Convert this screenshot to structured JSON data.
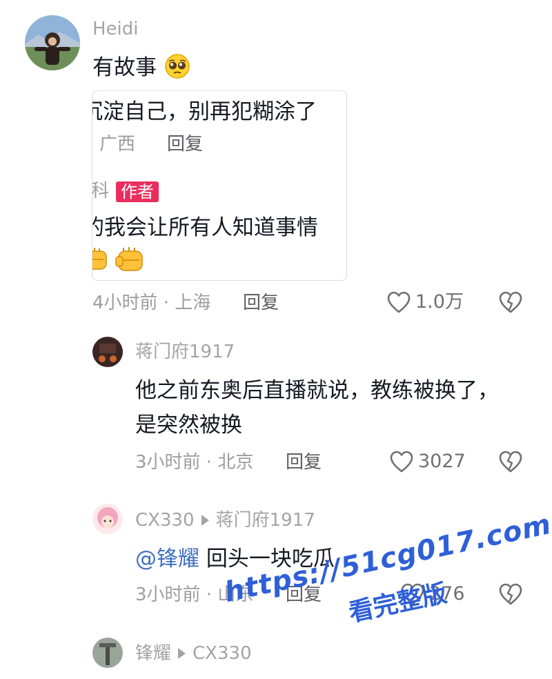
{
  "comment_main": {
    "username": "Heidi",
    "text": "有故事",
    "emoji": "pleading-face-emoji",
    "quoted": {
      "line1": "沉淀自己，别再犯糊涂了",
      "line1_location": "广西",
      "line1_reply": "回复",
      "author_name": "科",
      "author_badge": "作者",
      "author_text": "的我会让所有人知道事情",
      "emoji": "raised-fist-emoji"
    },
    "time_location": "4小时前 · 上海",
    "reply_label": "回复",
    "likes": "1.0万"
  },
  "reply1": {
    "username": "蒋门府1917",
    "text_line1": "他之前东奥后直播就说，教练被换了，",
    "text_line2": "是突然被换",
    "time_location": "3小时前 · 北京",
    "reply_label": "回复",
    "likes": "3027"
  },
  "reply2": {
    "username": "CX330",
    "reply_to": "蒋门府1917",
    "mention": "@锋耀",
    "text": "回头一块吃瓜",
    "time_location": "3小时前 · 山东",
    "reply_label": "回复",
    "likes": "276"
  },
  "reply3": {
    "username": "锋耀",
    "reply_to": "CX330"
  },
  "watermark": {
    "line1": "https://51cg017.com",
    "line2": "看完整版"
  },
  "colors": {
    "badge": "#ea2d5d",
    "mention": "#3d6fc2",
    "watermark": "#2f5fd8"
  }
}
